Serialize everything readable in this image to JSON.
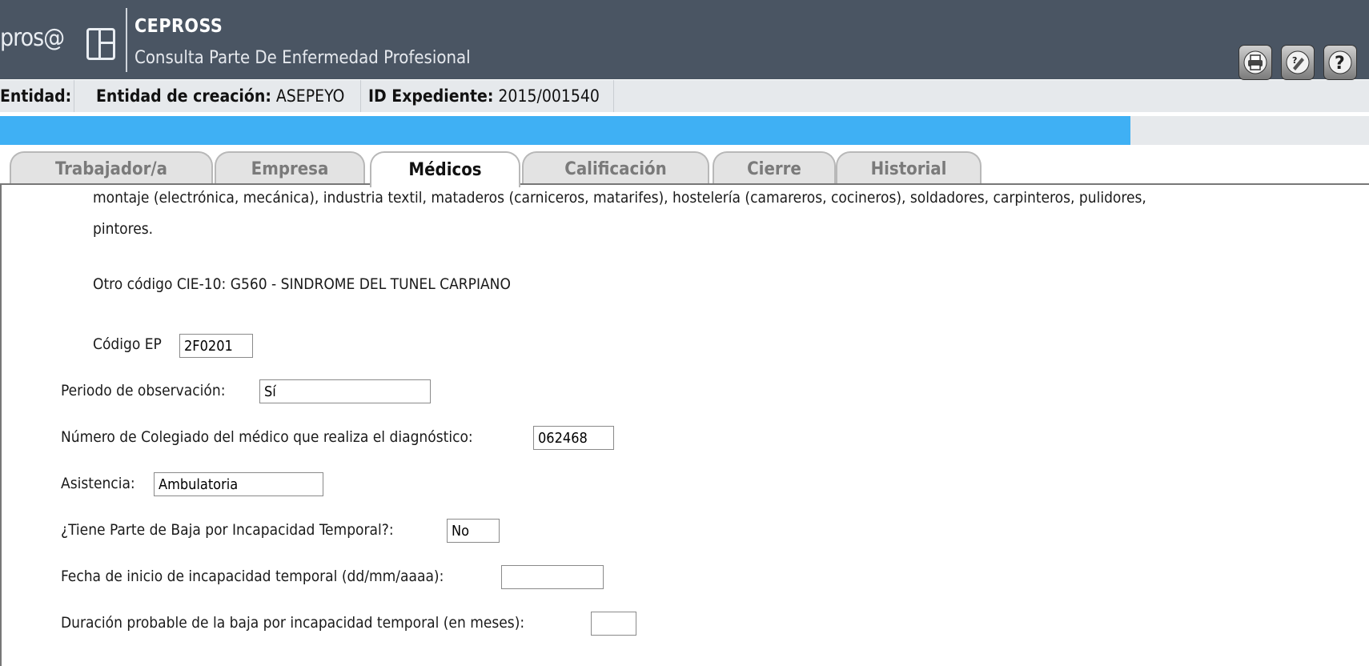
{
  "header": {
    "logo_text": "pros@",
    "title": "CEPROSS",
    "subtitle": "Consulta Parte De Enfermedad Profesional",
    "buttons": [
      {
        "name": "print-button",
        "icon": "printer-icon"
      },
      {
        "name": "help-wizard-button",
        "icon": "help-pen-icon"
      },
      {
        "name": "help-button",
        "icon": "question-icon"
      }
    ]
  },
  "info_bar": {
    "entidad_label": "Entidad:",
    "entidad_creacion_label": "Entidad de creación:",
    "entidad_creacion_value": "ASEPEYO",
    "id_expediente_label": "ID Expediente:",
    "id_expediente_value": "2015/001540"
  },
  "tabs": [
    {
      "label": "Trabajador/a",
      "active": false
    },
    {
      "label": "Empresa",
      "active": false
    },
    {
      "label": "Médicos",
      "active": true
    },
    {
      "label": "Calificación",
      "active": false
    },
    {
      "label": "Cierre",
      "active": false
    },
    {
      "label": "Historial",
      "active": false
    }
  ],
  "content": {
    "description_line1": "montaje (electrónica, mecánica), industria textil, mataderos (carniceros, matarifes), hostelería (camareros, cocineros), soldadores, carpinteros, pulidores,",
    "description_line2": "pintores.",
    "otro_codigo": "Otro código CIE-10: G560 - SINDROME DEL TUNEL CARPIANO",
    "codigo_ep": {
      "label": "Código EP",
      "value": "2F0201"
    },
    "periodo_observacion": {
      "label": "Periodo de observación:",
      "value": "Sí"
    },
    "numero_colegiado": {
      "label": "Número de Colegiado del médico que realiza el diagnóstico:",
      "value": "062468"
    },
    "asistencia": {
      "label": "Asistencia:",
      "value": "Ambulatoria"
    },
    "parte_baja": {
      "label": "¿Tiene Parte de Baja por Incapacidad Temporal?:",
      "value": "No"
    },
    "fecha_inicio": {
      "label": "Fecha de inicio de incapacidad temporal (dd/mm/aaaa):",
      "value": ""
    },
    "duracion": {
      "label": "Duración probable de la baja por incapacidad temporal (en meses):",
      "value": ""
    }
  },
  "colors": {
    "header_bg": "#4a5563",
    "info_bar_bg": "#e6e9ec",
    "accent_blue": "#3fb0f4",
    "tab_inactive_bg": "#e3e3e3"
  }
}
